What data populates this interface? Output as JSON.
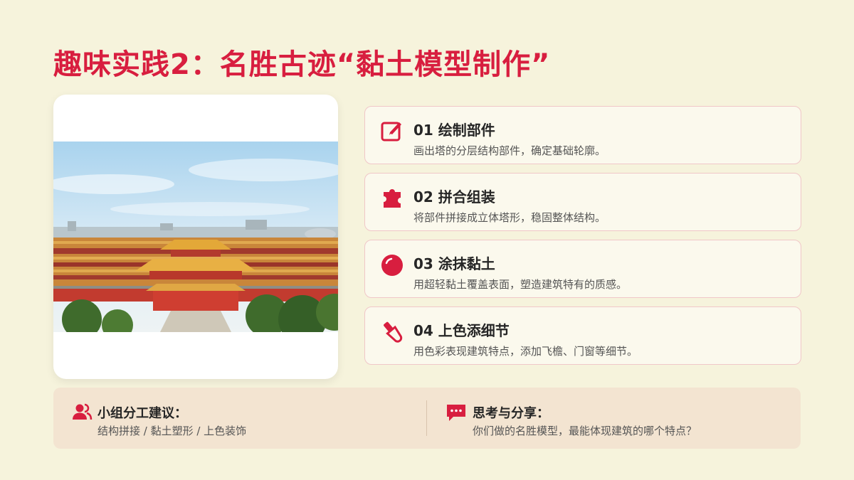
{
  "title": "趣味实践2：名胜古迹“黏土模型制作”",
  "colors": {
    "accent": "#d81e3f",
    "background": "#f6f3dc",
    "card_border": "#f0c7c8",
    "footer_bg": "#f3e4d1"
  },
  "photo": {
    "subject": "forbidden-city-aerial-photo"
  },
  "steps": [
    {
      "icon": "edit-icon",
      "title": "01 绘制部件",
      "desc": "画出塔的分层结构部件，确定基础轮廓。"
    },
    {
      "icon": "puzzle-icon",
      "title": "02 拼合组装",
      "desc": "将部件拼接成立体塔形，稳固整体结构。"
    },
    {
      "icon": "circle-icon",
      "title": "03 涂抹黏土",
      "desc": "用超轻黏土覆盖表面，塑造建筑特有的质感。"
    },
    {
      "icon": "paintbrush-icon",
      "title": "04 上色添细节",
      "desc": "用色彩表现建筑特点，添加飞檐、门窗等细节。"
    }
  ],
  "footer": {
    "left": {
      "icon": "users-icon",
      "title": "小组分工建议：",
      "desc": "结构拼接 / 黏土塑形 / 上色装饰"
    },
    "right": {
      "icon": "chat-bubble-icon",
      "title": "思考与分享：",
      "desc": "你们做的名胜模型，最能体现建筑的哪个特点？"
    }
  }
}
